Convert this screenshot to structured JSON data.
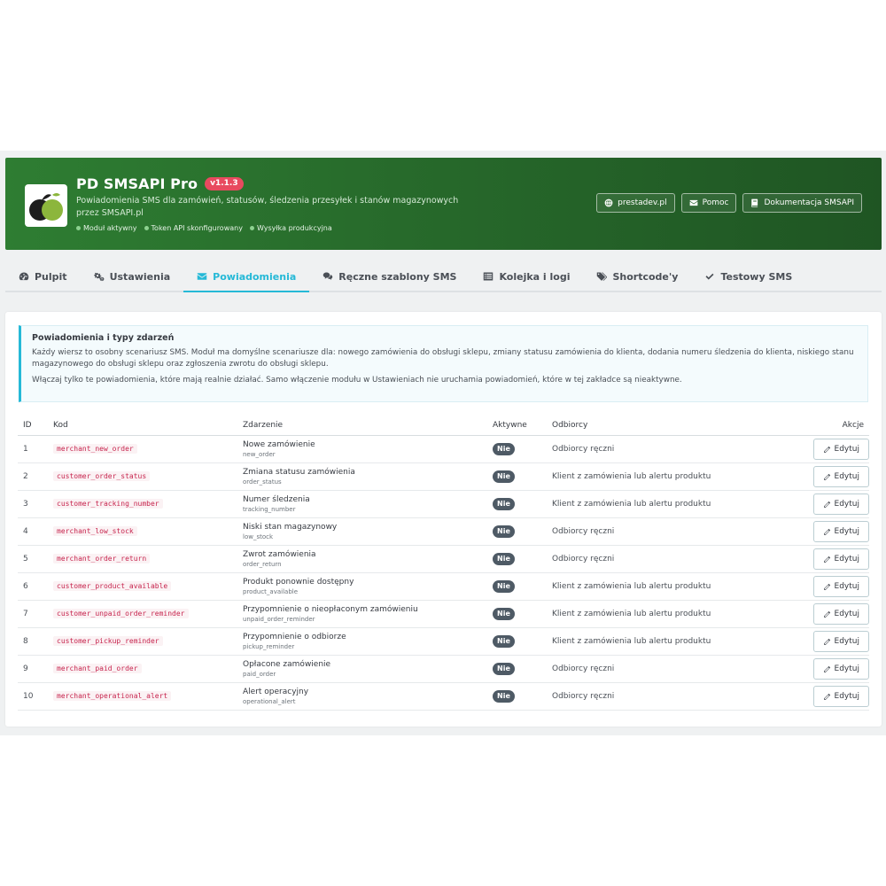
{
  "header": {
    "title": "PD SMSAPI Pro",
    "version": "v1.1.3",
    "description": "Powiadomienia SMS dla zamówień, statusów, śledzenia przesyłek i stanów magazynowych przez SMSAPI.pl",
    "statuses": [
      "Moduł aktywny",
      "Token API skonfigurowany",
      "Wysyłka produkcyjna"
    ],
    "buttons": [
      {
        "label": "prestadev.pl",
        "icon": "globe-icon"
      },
      {
        "label": "Pomoc",
        "icon": "envelope-icon"
      },
      {
        "label": "Dokumentacja SMSAPI",
        "icon": "book-icon"
      }
    ]
  },
  "tabs": [
    {
      "label": "Pulpit",
      "icon": "dashboard-icon"
    },
    {
      "label": "Ustawienia",
      "icon": "gears-icon"
    },
    {
      "label": "Powiadomienia",
      "icon": "envelope-icon"
    },
    {
      "label": "Ręczne szablony SMS",
      "icon": "comments-icon"
    },
    {
      "label": "Kolejka i logi",
      "icon": "list-icon"
    },
    {
      "label": "Shortcode'y",
      "icon": "tags-icon"
    },
    {
      "label": "Testowy SMS",
      "icon": "check-icon"
    }
  ],
  "active_tab": "Powiadomienia",
  "info": {
    "title": "Powiadomienia i typy zdarzeń",
    "p1": "Każdy wiersz to osobny scenariusz SMS. Moduł ma domyślne scenariusze dla: nowego zamówienia do obsługi sklepu, zmiany statusu zamówienia do klienta, dodania numeru śledzenia do klienta, niskiego stanu magazynowego do obsługi sklepu oraz zgłoszenia zwrotu do obsługi sklepu.",
    "p2": "Włączaj tylko te powiadomienia, które mają realnie działać. Samo włączenie modułu w Ustawieniach nie uruchamia powiadomień, które w tej zakładce są nieaktywne."
  },
  "table": {
    "headers": {
      "id": "ID",
      "kod": "Kod",
      "event": "Zdarzenie",
      "active": "Aktywne",
      "recipients": "Odbiorcy",
      "actions": "Akcje"
    },
    "edit_label": "Edytuj",
    "rows": [
      {
        "id": "1",
        "code": "merchant_new_order",
        "event": "Nowe zamówienie",
        "event_key": "new_order",
        "active": "Nie",
        "recipients": "Odbiorcy ręczni"
      },
      {
        "id": "2",
        "code": "customer_order_status",
        "event": "Zmiana statusu zamówienia",
        "event_key": "order_status",
        "active": "Nie",
        "recipients": "Klient z zamówienia lub alertu produktu"
      },
      {
        "id": "3",
        "code": "customer_tracking_number",
        "event": "Numer śledzenia",
        "event_key": "tracking_number",
        "active": "Nie",
        "recipients": "Klient z zamówienia lub alertu produktu"
      },
      {
        "id": "4",
        "code": "merchant_low_stock",
        "event": "Niski stan magazynowy",
        "event_key": "low_stock",
        "active": "Nie",
        "recipients": "Odbiorcy ręczni"
      },
      {
        "id": "5",
        "code": "merchant_order_return",
        "event": "Zwrot zamówienia",
        "event_key": "order_return",
        "active": "Nie",
        "recipients": "Odbiorcy ręczni"
      },
      {
        "id": "6",
        "code": "customer_product_available",
        "event": "Produkt ponownie dostępny",
        "event_key": "product_available",
        "active": "Nie",
        "recipients": "Klient z zamówienia lub alertu produktu"
      },
      {
        "id": "7",
        "code": "customer_unpaid_order_reminder",
        "event": "Przypomnienie o nieopłaconym zamówieniu",
        "event_key": "unpaid_order_reminder",
        "active": "Nie",
        "recipients": "Klient z zamówienia lub alertu produktu"
      },
      {
        "id": "8",
        "code": "customer_pickup_reminder",
        "event": "Przypomnienie o odbiorze",
        "event_key": "pickup_reminder",
        "active": "Nie",
        "recipients": "Klient z zamówienia lub alertu produktu"
      },
      {
        "id": "9",
        "code": "merchant_paid_order",
        "event": "Opłacone zamówienie",
        "event_key": "paid_order",
        "active": "Nie",
        "recipients": "Odbiorcy ręczni"
      },
      {
        "id": "10",
        "code": "merchant_operational_alert",
        "event": "Alert operacyjny",
        "event_key": "operational_alert",
        "active": "Nie",
        "recipients": "Odbiorcy ręczni"
      }
    ]
  },
  "colors": {
    "accent": "#25b9d7",
    "banner": "#2e7d32",
    "code": "#c7254e",
    "badge": "#4e5a65"
  }
}
